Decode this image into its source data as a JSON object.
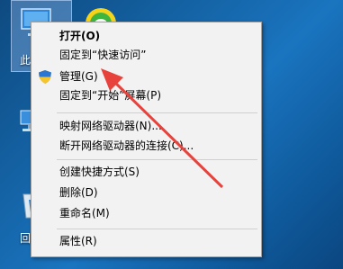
{
  "desktop": {
    "icons": [
      {
        "name": "this-pc",
        "label": "此"
      },
      {
        "name": "recycle",
        "label": "回"
      }
    ]
  },
  "context_menu": {
    "items": [
      {
        "id": "open",
        "label": "打开(O)",
        "bold": true
      },
      {
        "id": "pin-quick",
        "label": "固定到“快速访问”"
      },
      {
        "id": "manage",
        "label": "管理(G)",
        "icon": "shield-icon"
      },
      {
        "id": "pin-start",
        "label": "固定到“开始”屏幕(P)"
      },
      {
        "id": "map-drive",
        "label": "映射网络驱动器(N)..."
      },
      {
        "id": "disconnect-drive",
        "label": "断开网络驱动器的连接(C)..."
      },
      {
        "id": "create-shortcut",
        "label": "创建快捷方式(S)"
      },
      {
        "id": "delete",
        "label": "删除(D)"
      },
      {
        "id": "rename",
        "label": "重命名(M)"
      },
      {
        "id": "properties",
        "label": "属性(R)"
      }
    ]
  },
  "annotation": {
    "arrow_color": "#e8423c"
  }
}
